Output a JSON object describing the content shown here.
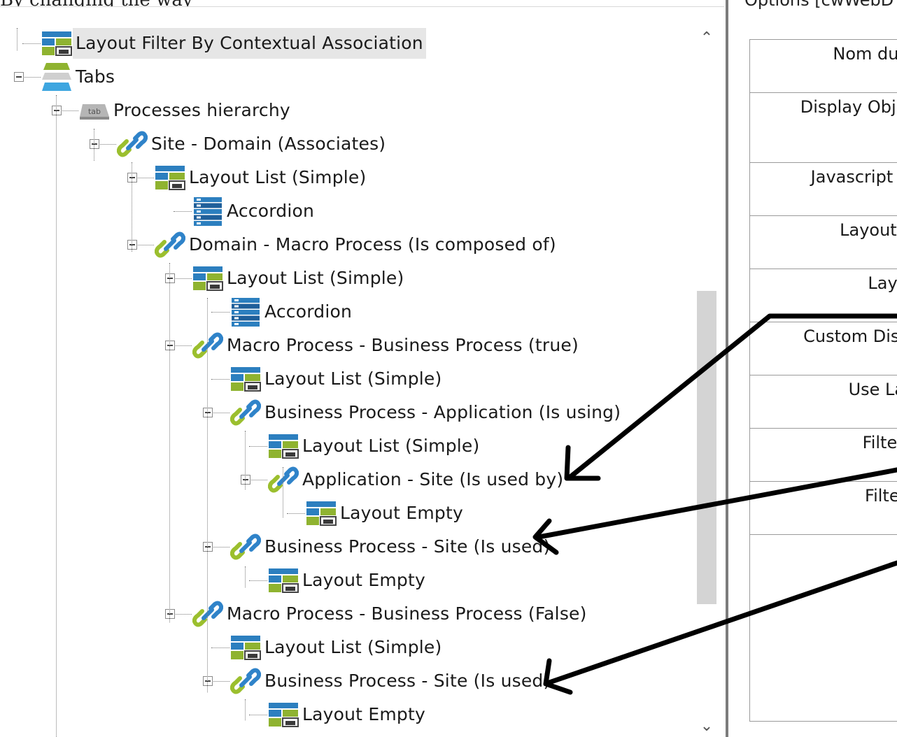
{
  "top_clipped_text": "By changing the way",
  "tree": {
    "nodes": [
      {
        "label": "Layout Filter By Contextual Association",
        "icon": "layout-icon",
        "selected": true
      },
      {
        "label": "Tabs",
        "icon": "tabs-icon"
      },
      {
        "label": "Processes hierarchy",
        "icon": "tab-icon"
      },
      {
        "label": "Site - Domain (Associates)",
        "icon": "link-icon"
      },
      {
        "label": "Layout List (Simple)",
        "icon": "layout-icon"
      },
      {
        "label": "Accordion",
        "icon": "accordion-icon"
      },
      {
        "label": "Domain - Macro Process (Is composed of)",
        "icon": "link-icon"
      },
      {
        "label": "Layout List (Simple)",
        "icon": "layout-icon"
      },
      {
        "label": "Accordion",
        "icon": "accordion-icon"
      },
      {
        "label": "Macro Process - Business Process (true)",
        "icon": "link-icon"
      },
      {
        "label": "Layout List (Simple)",
        "icon": "layout-icon"
      },
      {
        "label": "Business Process - Application (Is using)",
        "icon": "link-icon"
      },
      {
        "label": "Layout List (Simple)",
        "icon": "layout-icon"
      },
      {
        "label": "Application - Site (Is used by)",
        "icon": "link-icon"
      },
      {
        "label": "Layout Empty",
        "icon": "layout-icon"
      },
      {
        "label": "Business Process - Site (Is used)",
        "icon": "link-icon"
      },
      {
        "label": "Layout Empty",
        "icon": "layout-icon"
      },
      {
        "label": "Macro Process - Business Process (False)",
        "icon": "link-icon"
      },
      {
        "label": "Layout List (Simple)",
        "icon": "layout-icon"
      },
      {
        "label": "Business Process - Site (Is used)",
        "icon": "link-icon"
      },
      {
        "label": "Layout Empty",
        "icon": "layout-icon"
      }
    ],
    "tab_icon_text": "tab",
    "scroll_up": "⌃",
    "scroll_down": "⌄"
  },
  "options_panel": {
    "title": "Options [cwWebD",
    "properties": [
      "Nom du no",
      "Display Object",
      "Javascript Cla",
      "Layout Na",
      "Layout",
      "Custom Displa",
      "Use Layo",
      "Filter In",
      "Filter O"
    ]
  },
  "colors": {
    "selection": "#e6e6e6",
    "link_green": "#9bbf2e",
    "link_blue": "#2f83c9",
    "layout_blue": "#2c7fbf",
    "layout_green": "#8fb330"
  }
}
